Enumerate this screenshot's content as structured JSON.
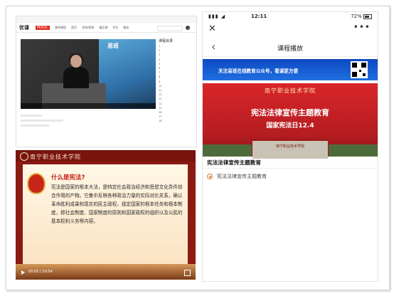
{
  "web": {
    "logo": "优课",
    "logo_badge": "MOOC",
    "nav": [
      "我的课程",
      "首页",
      "学校/机构",
      "精品课",
      "专业",
      "服务"
    ],
    "brand": "易班",
    "outline_title": "课程目录",
    "outline_items": [
      "1",
      "2",
      "3",
      "4",
      "5",
      "6",
      "7",
      "8",
      "9",
      "10",
      "11",
      "12",
      "13",
      "14",
      "15",
      "16",
      "17",
      "18"
    ]
  },
  "slide": {
    "school": "南宁职业技术学院",
    "question": "什么是宪法?",
    "text": "宪法是国家的根本大法，是特定社会政治经济和思想文化条件综合作用的产物。它集中反映各种政治力量的实际对比关系，确认革命胜利成果和现实的民主政权，规定国家的根本任务和根本制度，即社会制度、国家制度的原则和国家政权的组织以及公民的基本权利义务等内容。",
    "time": "00:05 / 10:54"
  },
  "phone": {
    "status_time": "12:11",
    "battery": "72%",
    "title": "课程播放",
    "banner": "关注易班在线教育公众号，看课更方便",
    "poster_school": "南宁职业技术学院",
    "poster_title": "宪法法律宣传主题教育",
    "poster_subtitle": "国家宪法日12.4",
    "building_sign": "南宁职业技术学院",
    "caption": "宪法法律宣传主题教育",
    "lesson": "宪法法律宣传主题教育"
  }
}
